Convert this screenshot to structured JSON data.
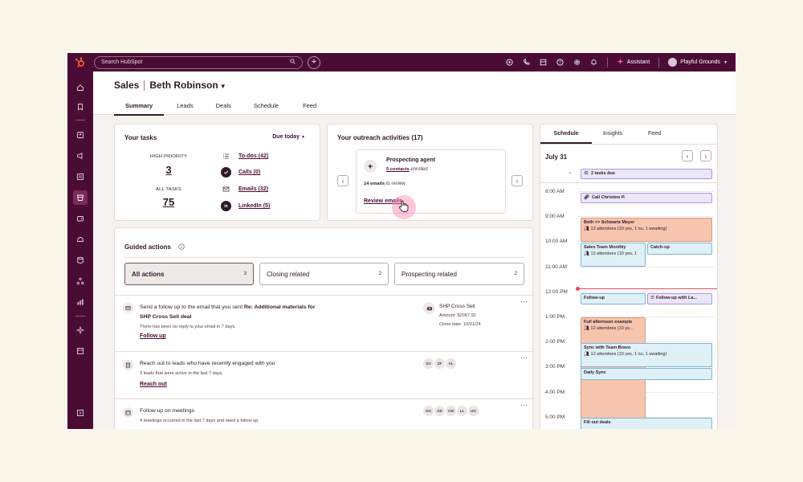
{
  "topbar": {
    "search_placeholder": "Search HubSpot",
    "plus_label": "+",
    "assistant": "Assistant",
    "account": "Playful Grounds"
  },
  "header": {
    "section": "Sales",
    "user": "Beth Robinson",
    "tabs": [
      {
        "label": "Summary",
        "active": true
      },
      {
        "label": "Leads"
      },
      {
        "label": "Deals"
      },
      {
        "label": "Schedule"
      },
      {
        "label": "Feed"
      }
    ]
  },
  "tasks": {
    "title": "Your tasks",
    "filter": "Due today",
    "high_priority_label": "HIGH PRIORITY",
    "high_priority_value": "3",
    "all_tasks_label": "ALL TASKS",
    "all_tasks_value": "75",
    "items": [
      {
        "label": "To-dos (42)",
        "icon": "todo-icon"
      },
      {
        "label": "Calls (0)",
        "icon": "phone-check-icon"
      },
      {
        "label": "Emails (32)",
        "icon": "email-icon"
      },
      {
        "label": "LinkedIn (5)",
        "icon": "linkedin-icon"
      }
    ]
  },
  "outreach": {
    "title": "Your outreach activities (17)",
    "agent_name": "Prospecting agent",
    "contacts_link": "5 contacts",
    "enrolled": "enrolled",
    "emails_count": "14 emails",
    "to_review": "to review",
    "review_link": "Review emails"
  },
  "guided": {
    "title": "Guided actions",
    "filters": [
      {
        "label": "All actions",
        "count": "3",
        "active": true
      },
      {
        "label": "Closing related",
        "count": "2"
      },
      {
        "label": "Prospecting related",
        "count": "2"
      }
    ],
    "actions": [
      {
        "line1a": "Send a follow up to the email that you sent ",
        "line1b": "Re: Additional materials for",
        "line2": "SHP Cross Sell deal",
        "desc": "There has been no reply to your email in 7 days.",
        "cta": "Follow up",
        "deal_name": "SHP Cross Sell",
        "amount": "Amount: $2067.92",
        "close_date": "Close date: 10/01/24"
      },
      {
        "title": "Reach out to leads who have recently engaged with you",
        "desc": "3 leads that were active in the last 7 days.",
        "cta": "Reach out",
        "chips": [
          "DJ",
          "ZF",
          "AL"
        ]
      },
      {
        "title": "Follow up on meetings",
        "desc": "4 meetings occurred in the last 7 days and need a follow up",
        "chips": [
          "GG",
          "AD",
          "CM",
          "LL",
          "UO"
        ]
      }
    ]
  },
  "schedule": {
    "tabs": [
      {
        "label": "Schedule",
        "active": true
      },
      {
        "label": "Insights"
      },
      {
        "label": "Feed"
      }
    ],
    "date": "July 31",
    "tasks_due": "2 tasks due",
    "times": [
      "8:00 AM",
      "9:00 AM",
      "10:00 AM",
      "11:00 AM",
      "12:00 PM",
      "1:00 PM",
      "2:00 PM",
      "3:00 PM",
      "4:00 PM",
      "5:00 PM"
    ],
    "events": {
      "call": "Call Christine P.",
      "beth_title": "Beth <> Schwartz Meyer",
      "beth_sub": "12 attendees (10 yes, 1 no, 1 awaiting)",
      "monthly_title": "Sales Team Monthly",
      "monthly_sub": "12 attendees (10 yes, 1",
      "catchup": "Catch-up",
      "followup": "Follow-up",
      "followup_la": "Follow-up with La...",
      "afternoon_title": "Full afternoon example",
      "afternoon_sub": "12 attendees (10 ye...",
      "sync_title": "Sync with Team Bravo",
      "sync_sub": "12 attendees (10 yes, 1 no, 1 awaiting)",
      "daily": "Daily Sync",
      "fill": "Fill out deals"
    }
  },
  "colors": {
    "brand_dark": "#4a0c34",
    "accent_orange": "#ff5c35",
    "event_blue": "#dff0f7",
    "event_orange": "#f7c5ae"
  }
}
